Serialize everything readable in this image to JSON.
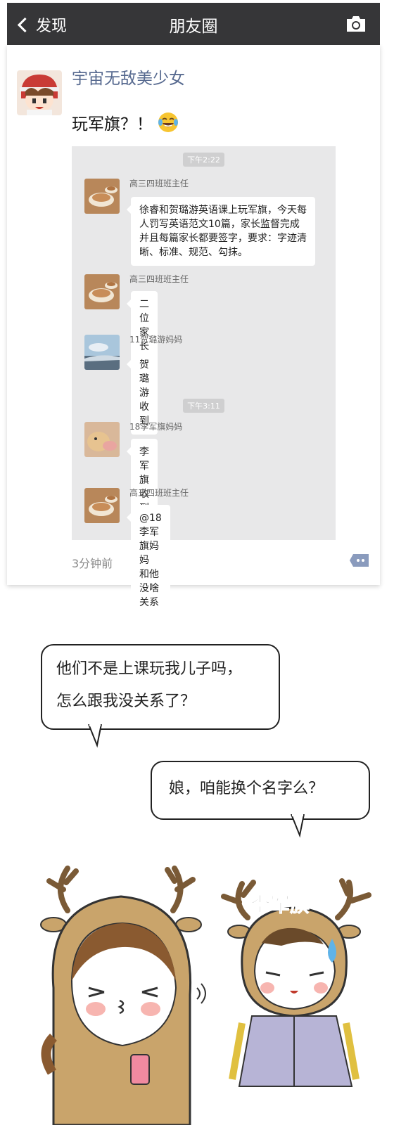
{
  "topbar": {
    "back_label": "发现",
    "title": "朋友圈",
    "camera_icon": "camera-icon"
  },
  "post": {
    "poster_name": "宇宙无敌美少女",
    "text": "玩军旗？！",
    "emoji_icon": "laugh-cry-emoji",
    "time_ago": "3分钟前",
    "chat": {
      "timestamps": [
        "下午2:22",
        "下午3:11"
      ],
      "messages": [
        {
          "sender": "高三四班班主任",
          "text": "徐睿和贺璐游英语课上玩军旗，今天每人罚写英语范文10篇，家长监督完成并且每篇家长都要签字，要求：字迹清晰、标准、规范、勾抹。"
        },
        {
          "sender": "高三四班班主任",
          "text": "二位家长收到请回复"
        },
        {
          "sender": "11贺璐游妈妈",
          "text": "贺璐游收到"
        },
        {
          "sender": "18李军旗妈妈",
          "text": "李军旗收到"
        },
        {
          "sender": "高三四班班主任",
          "text": "@18李军旗妈妈  和他没啥关系"
        }
      ]
    }
  },
  "comic": {
    "bubble1_line1": "他们不是上课玩我儿子吗，",
    "bubble1_line2": "怎么跟我没关系了？",
    "bubble2": "娘，咱能换个名字么？",
    "boy_name": "李军旗"
  },
  "colors": {
    "topbar": "#363638",
    "name_link": "#56698f",
    "chat_bg": "#e8e8e9",
    "costume": "#c9a46b"
  }
}
